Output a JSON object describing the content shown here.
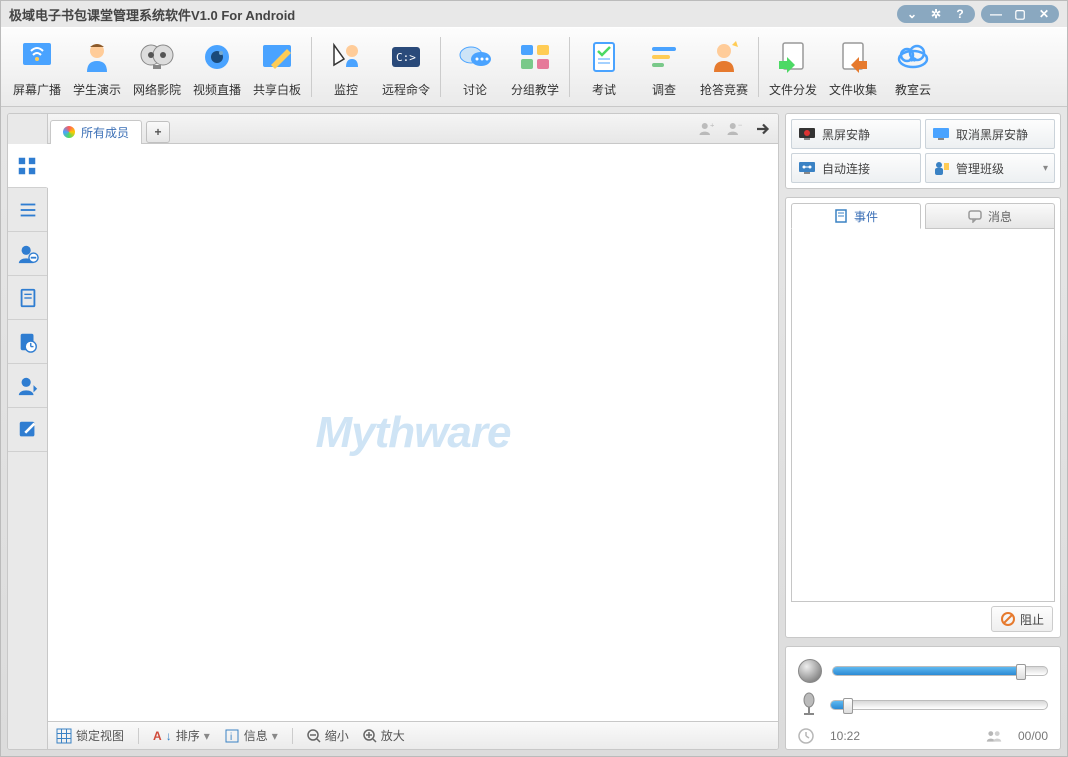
{
  "title": "极域电子书包课堂管理系统软件V1.0 For Android",
  "toolbar": [
    {
      "label": "屏幕广播",
      "icon": "broadcast"
    },
    {
      "label": "学生演示",
      "icon": "student"
    },
    {
      "label": "网络影院",
      "icon": "movie"
    },
    {
      "label": "视频直播",
      "icon": "camera"
    },
    {
      "label": "共享白板",
      "icon": "whiteboard"
    },
    {
      "label": "监控",
      "icon": "monitor",
      "sep_before": true
    },
    {
      "label": "远程命令",
      "icon": "command"
    },
    {
      "label": "讨论",
      "icon": "chat",
      "sep_before": true
    },
    {
      "label": "分组教学",
      "icon": "group"
    },
    {
      "label": "考试",
      "icon": "exam",
      "sep_before": true
    },
    {
      "label": "调查",
      "icon": "survey"
    },
    {
      "label": "抢答竞赛",
      "icon": "compete"
    },
    {
      "label": "文件分发",
      "icon": "filesend",
      "sep_before": true
    },
    {
      "label": "文件收集",
      "icon": "filecollect"
    },
    {
      "label": "教室云",
      "icon": "cloud"
    }
  ],
  "members_tab": "所有成员",
  "watermark": "Mythware",
  "statusbar": {
    "lock": "锁定视图",
    "sort": "排序",
    "info": "信息",
    "zoom_out": "缩小",
    "zoom_in": "放大"
  },
  "quick": {
    "black_silent": "黑屏安静",
    "cancel_black": "取消黑屏安静",
    "auto_connect": "自动连接",
    "manage_class": "管理班级"
  },
  "event_tabs": {
    "events": "事件",
    "messages": "消息"
  },
  "stop": "阻止",
  "time": "10:22",
  "count": "00/00",
  "sliders": {
    "speaker_fill": 88,
    "mic_fill": 8
  }
}
